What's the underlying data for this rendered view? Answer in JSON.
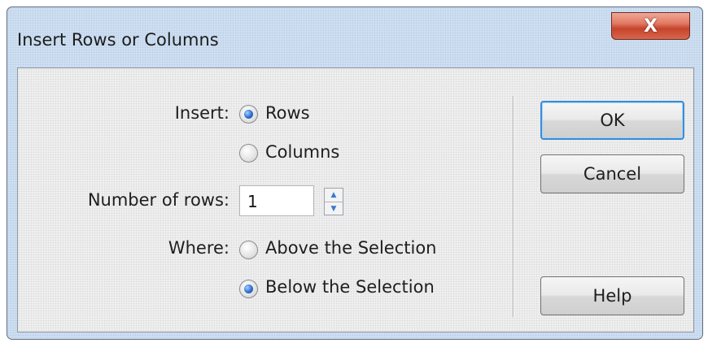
{
  "window": {
    "title": "Insert Rows or Columns"
  },
  "title_bar": {
    "close_glyph": "X"
  },
  "insert": {
    "label": "Insert:",
    "options": [
      {
        "label": "Rows",
        "checked": true
      },
      {
        "label": "Columns",
        "checked": false
      }
    ]
  },
  "number_of_rows": {
    "label": "Number of rows:",
    "value": "1"
  },
  "where": {
    "label": "Where:",
    "options": [
      {
        "label": "Above the Selection",
        "checked": false
      },
      {
        "label": "Below the Selection",
        "checked": true
      }
    ]
  },
  "buttons": {
    "ok": "OK",
    "cancel": "Cancel",
    "help": "Help"
  },
  "icons": {
    "close": "close-icon",
    "spin_up": "arrow-up-icon",
    "spin_down": "arrow-down-icon"
  },
  "colors": {
    "accent": "#3b8bd6",
    "close_button": "#c6442c",
    "chrome": "#cfdff1"
  }
}
